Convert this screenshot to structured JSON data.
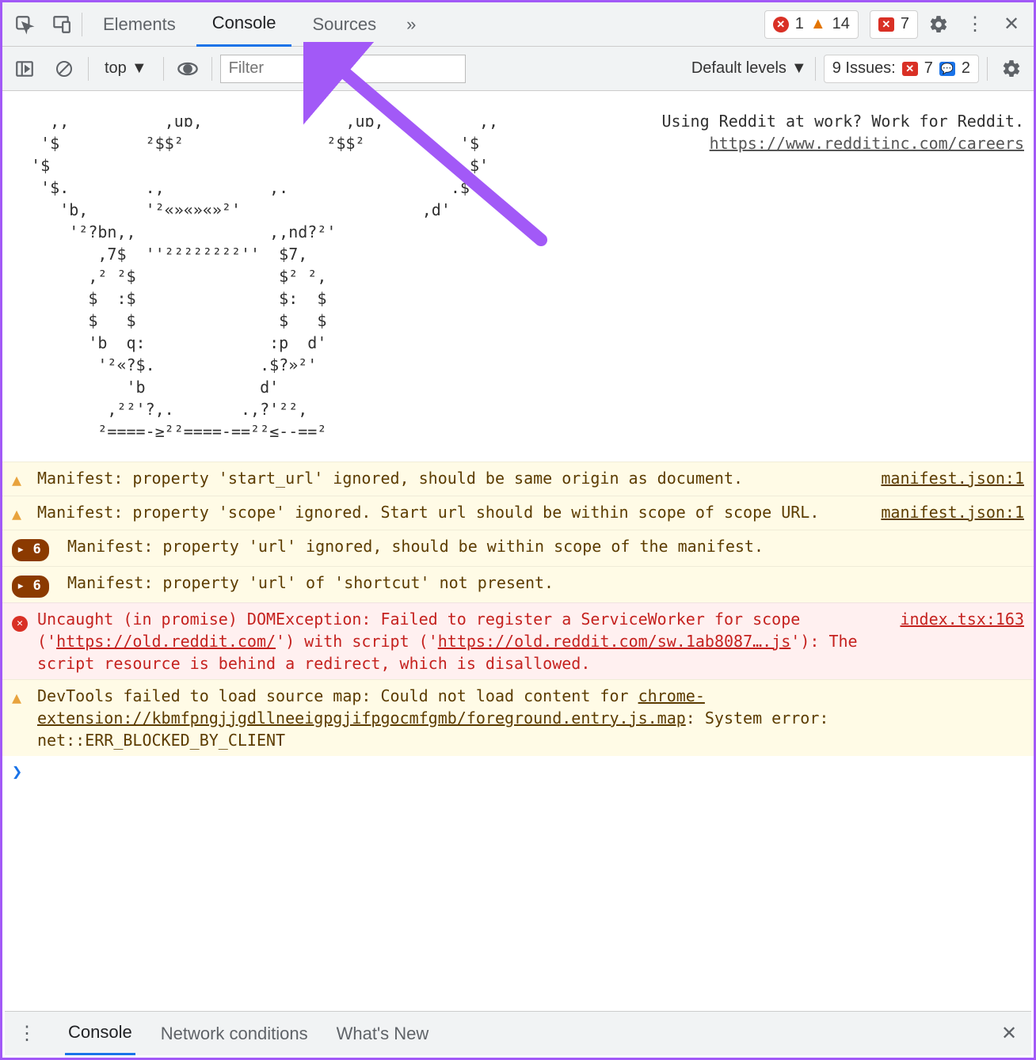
{
  "tabs": {
    "elements": "Elements",
    "console": "Console",
    "sources": "Sources"
  },
  "topbar": {
    "error_count": "1",
    "warn_count": "14",
    "feedback_count": "7"
  },
  "toolbar2": {
    "context": "top",
    "filter_placeholder": "Filter",
    "levels": "Default levels",
    "issues_label": "9 Issues:",
    "issues_err": "7",
    "issues_feedback": "2"
  },
  "ascii": "    ,,          ,uɒ,               ,uɒ,          ,,\n   '$         ²$$²               ²$$²          '$\n  '$                                            $'\n   '$.        .,           ,.                 .$'\n     'b,      '²«»«»«»²'                   ,d'\n      '²?bn,,              ,,nd?²'\n         ,7$  ''²²²²²²²²''  $7,\n        ,² ²$               $² ²,\n        $  :$               $:  $\n        $   $               $   $\n        'b  q:             :p  d'\n         '²«?$.           .$?»²'\n            'b            d'\n          ,²²'?,.       .,?'²²,\n         ²====-≥²²====-==²²≤-­-==²",
  "side_msg": "Using Reddit at work? Work for Reddit.",
  "side_url": "https://www.redditinc.com/careers",
  "logs": [
    {
      "type": "warn",
      "icon": "warn",
      "msg": "Manifest: property 'start_url' ignored, should be same origin as document.",
      "src": "manifest.json:1"
    },
    {
      "type": "warn",
      "icon": "warn",
      "msg": "Manifest: property 'scope' ignored. Start url should be within scope of scope URL.",
      "src": "manifest.json:1"
    },
    {
      "type": "warn",
      "icon": "count",
      "count": "6",
      "msg": "Manifest: property 'url' ignored, should be within scope of the manifest.",
      "src": ""
    },
    {
      "type": "warn",
      "icon": "count",
      "count": "6",
      "msg": "Manifest: property 'url' of 'shortcut' not present.",
      "src": ""
    },
    {
      "type": "err",
      "icon": "err",
      "msg_html": "Uncaught (in promise) DOMException: Failed to register a ServiceWorker for scope ('<a>https://old.reddit.com/</a>') with script ('<a>https://old.reddit.com/sw.1ab8087….js</a>'): The script resource is behind a redirect, which is disallowed.",
      "src": "index.tsx:163"
    },
    {
      "type": "warn",
      "icon": "warn",
      "msg_html": "DevTools failed to load source map: Could not load content for <a>chrome-extension://kbmfpngjjgdllneeigpgjifpgocmfgmb/foreground.entry.js.map</a>: System error: net::ERR_BLOCKED_BY_CLIENT",
      "src": ""
    }
  ],
  "prompt": "❯",
  "drawer": {
    "console": "Console",
    "network": "Network conditions",
    "whatsnew": "What's New"
  }
}
